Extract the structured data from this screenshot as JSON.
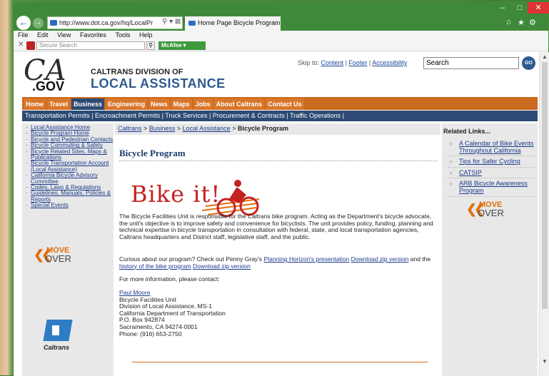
{
  "browser": {
    "address": "http://www.dot.ca.gov/hq/LocalPr",
    "address_domain": "ca.gov",
    "tab_title": "Home Page Bicycle Program",
    "menu": [
      "File",
      "Edit",
      "View",
      "Favorites",
      "Tools",
      "Help"
    ],
    "search_placeholder": "Secure Search",
    "mcafee_label": "McAfee"
  },
  "header": {
    "logo_ca": "CA",
    "logo_gov": ".GOV",
    "division_line1": "CALTRANS DIVISION OF",
    "division_line2": "LOCAL ASSISTANCE",
    "skip_to": "Skip to:",
    "skip_links": [
      "Content",
      "Footer",
      "Accessibility"
    ],
    "search_value": "Search",
    "go_label": "GO"
  },
  "nav_orange": [
    "Home",
    "Travel",
    "Business",
    "Engineering",
    "News",
    "Maps",
    "Jobs",
    "About Caltrans",
    "Contact Us"
  ],
  "nav_blue": [
    "Transportation Permits",
    "Encroachment Permits",
    "Truck Services",
    "Procurement & Contracts",
    "Traffic Operations"
  ],
  "left_links": [
    "Local Assistance Home",
    "Bicycle Program Home",
    "Bicycle and Pedestrian Contacts",
    "Bicycle Commuting & Safety",
    "Bicycle Related Sites, Maps & Publications",
    "Bicycle Transportation Account (Local Assistance)",
    "California Bicycle Advisory Committee",
    "Codes, Laws & Regulations",
    "Guidelines, Manuals, Policies & Reports",
    "Special Events"
  ],
  "move_over": {
    "line1": "MOVE",
    "line2": "OVER"
  },
  "caltrans_label": "Caltrans",
  "breadcrumb": {
    "items": [
      "Caltrans",
      "Business",
      "Local Assistance"
    ],
    "current": "Bicycle Program",
    "sep": ">"
  },
  "page_title": "Bicycle Program",
  "bike_it": "Bike it!",
  "body": {
    "p1_first": "The Bicycle Facilities Unit is responsible for the Caltrans bike program. Acting as the Department's bicycle advocate, the unit's objective is to improve safety and convenience for bicyclists. The unit provides policy, funding, planning and technical expertise in bicycle transportation in consultation with federal, state, and local transportation agencies, Caltrans headquarters and District staff, legislative staff, and the public.",
    "p2_pre": "Curious about our program? Check out Penny Gray's",
    "p2_link1": "Planning Horizon's presentation",
    "p2_link2": "Download zip version",
    "p2_mid": "and the",
    "p2_link3": "history of the bike program",
    "p2_link4": "Download zip version",
    "p3": "For more information, please contact:"
  },
  "contact": {
    "name": "Paul Moore",
    "lines": [
      "Bicycle Facilities Unit",
      "Division of Local Assistance, MS-1",
      "California Department of Transportation",
      "P.O. Box 942874",
      "Sacramento, CA 94274-0001",
      "Phone: (916) 653-2750"
    ]
  },
  "related": {
    "title": "Related Links...",
    "links": [
      "A Calendar of Bike Events Throughout California",
      "Tips for Safer Cycling",
      "CATSIP",
      "ARB Bicycle Awareness Program"
    ]
  },
  "colors": {
    "nav_orange": "#c96a1e",
    "nav_blue": "#2c4a73",
    "link": "#1a3a8a",
    "title_bar": "#3f8a3a"
  }
}
